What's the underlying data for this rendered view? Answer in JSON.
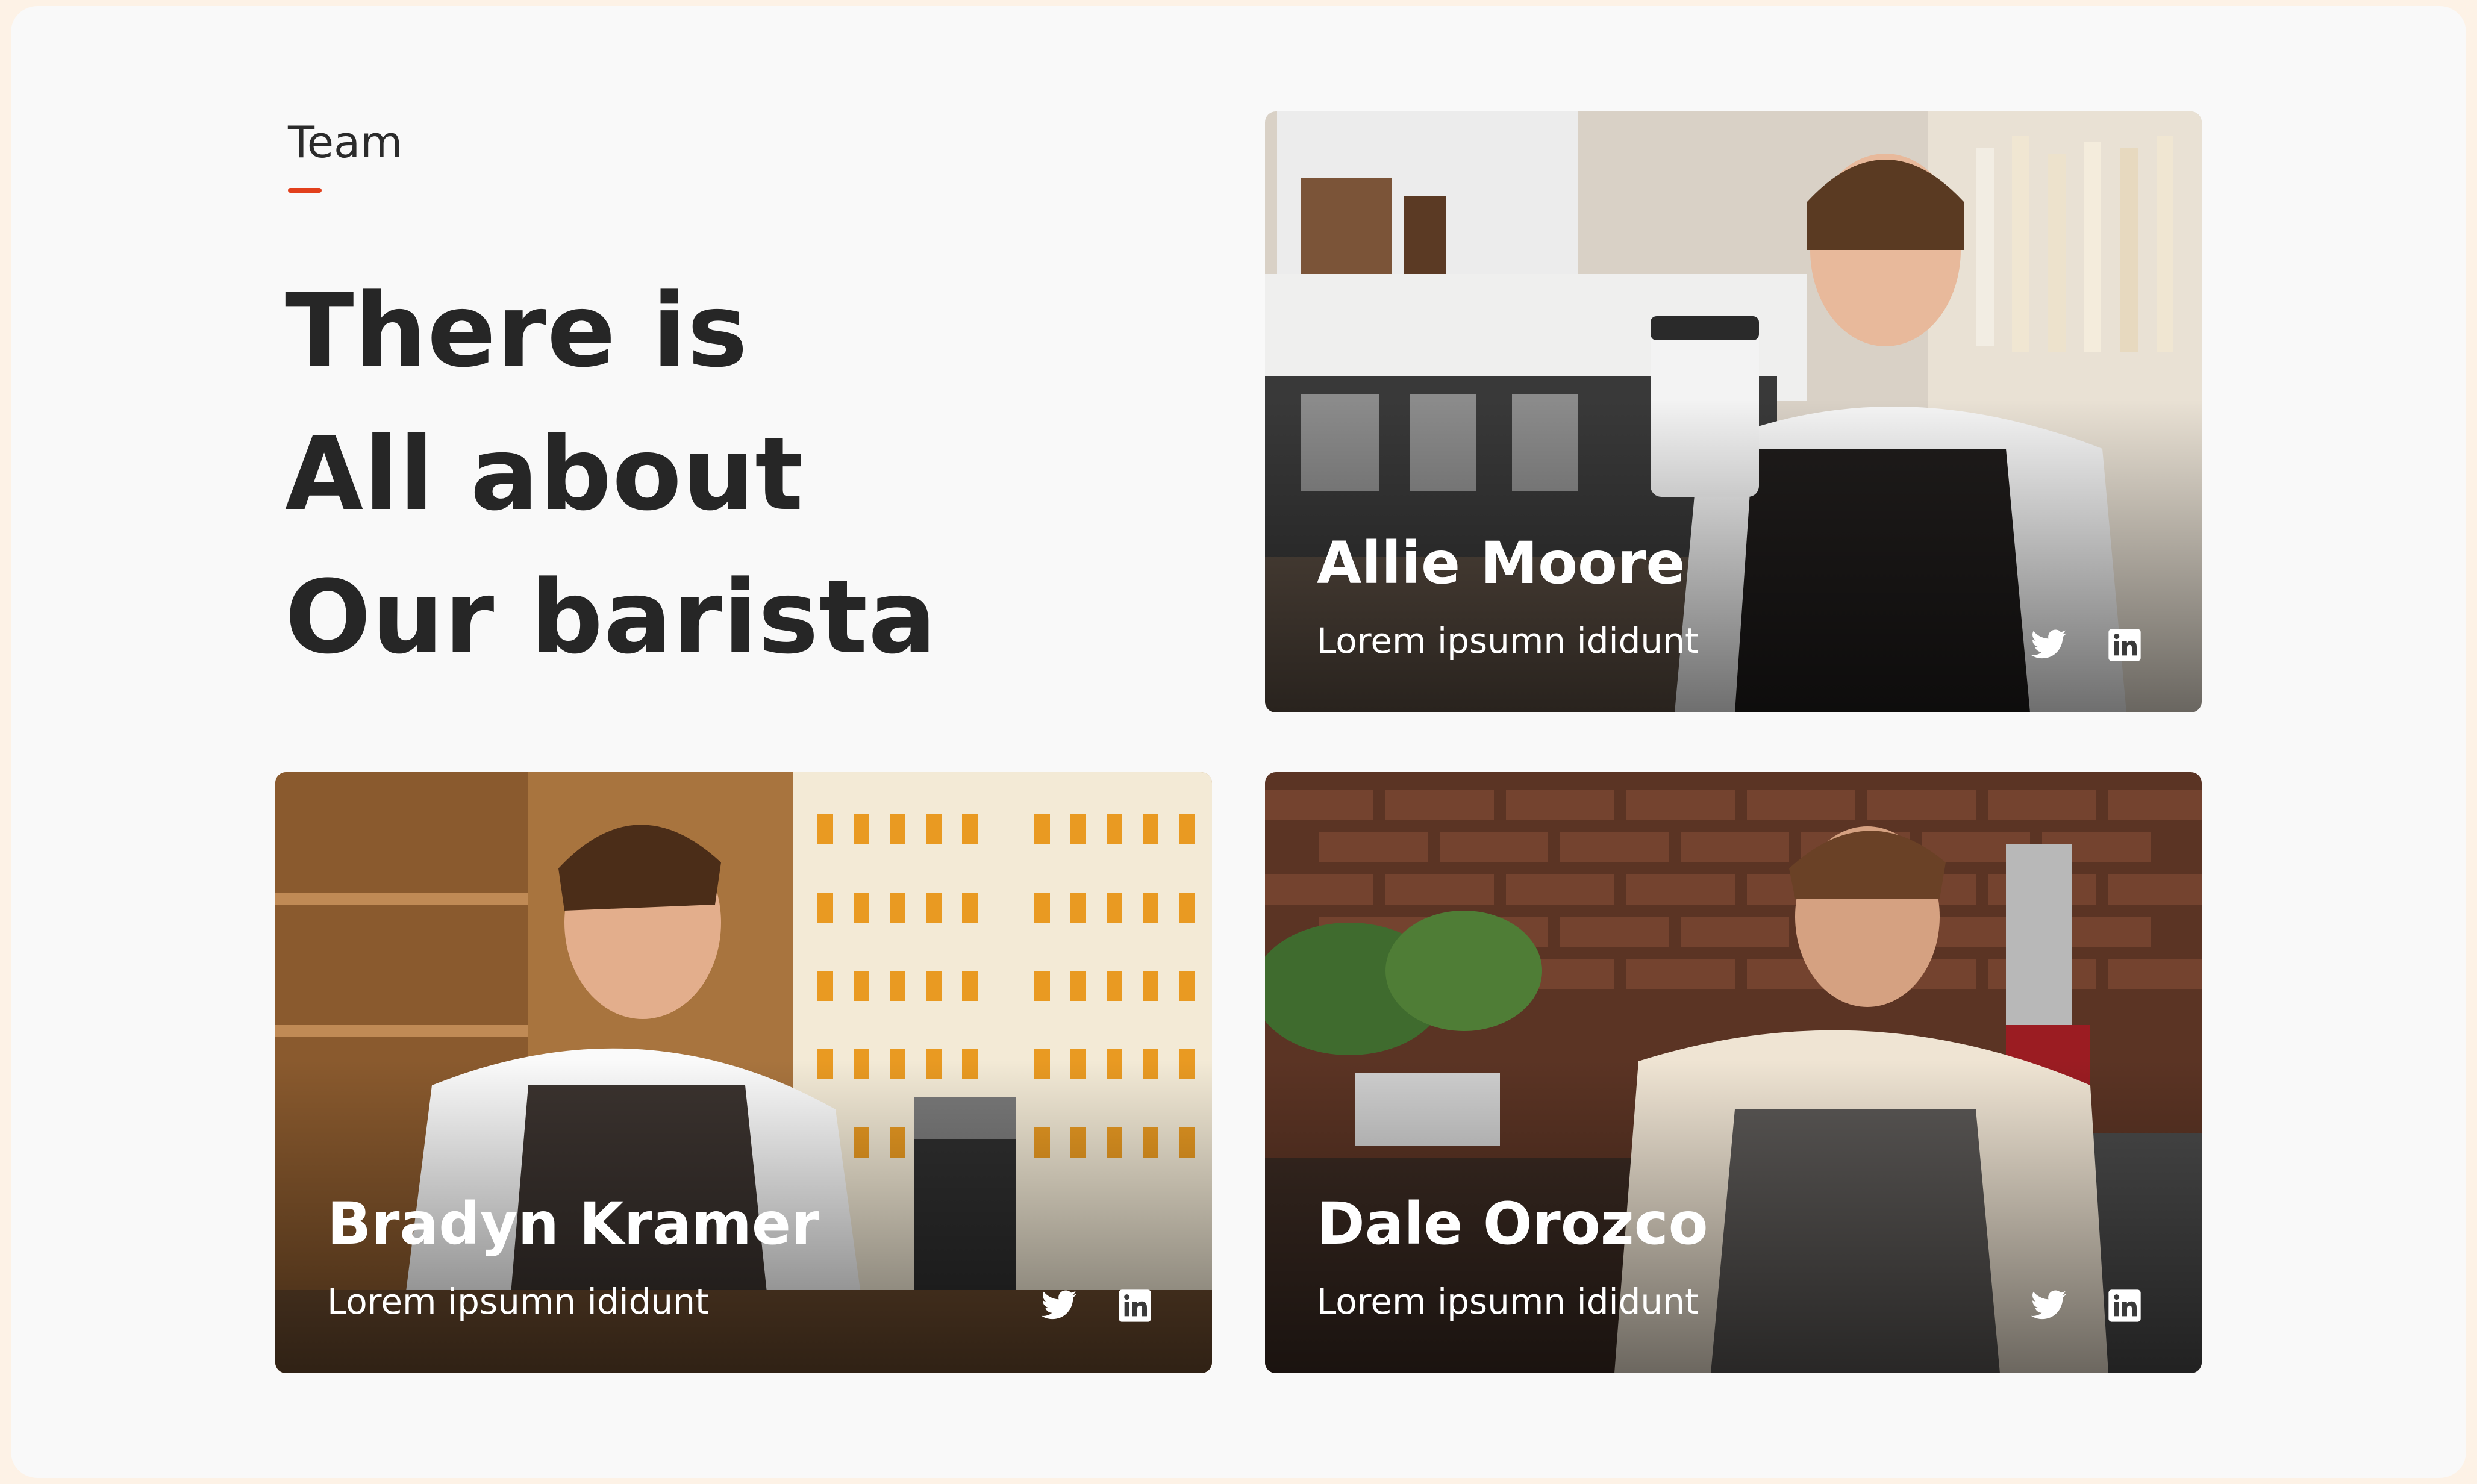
{
  "section": {
    "eyebrow": "Team",
    "headline": [
      "There is",
      "All about",
      "Our barista"
    ]
  },
  "team": [
    {
      "name": "Allie Moore",
      "role": "Lorem ipsumn ididunt"
    },
    {
      "name": "Bradyn Kramer",
      "role": "Lorem ipsumn ididunt"
    },
    {
      "name": "Dale Orozco",
      "role": "Lorem ipsumn ididunt"
    }
  ],
  "icons": {
    "twitter": "twitter-icon",
    "linkedin": "linkedin-icon"
  },
  "colors": {
    "accent": "#e2401c",
    "heading": "#262626",
    "panel": "#f9f9f9",
    "page": "#fdf2e6"
  }
}
